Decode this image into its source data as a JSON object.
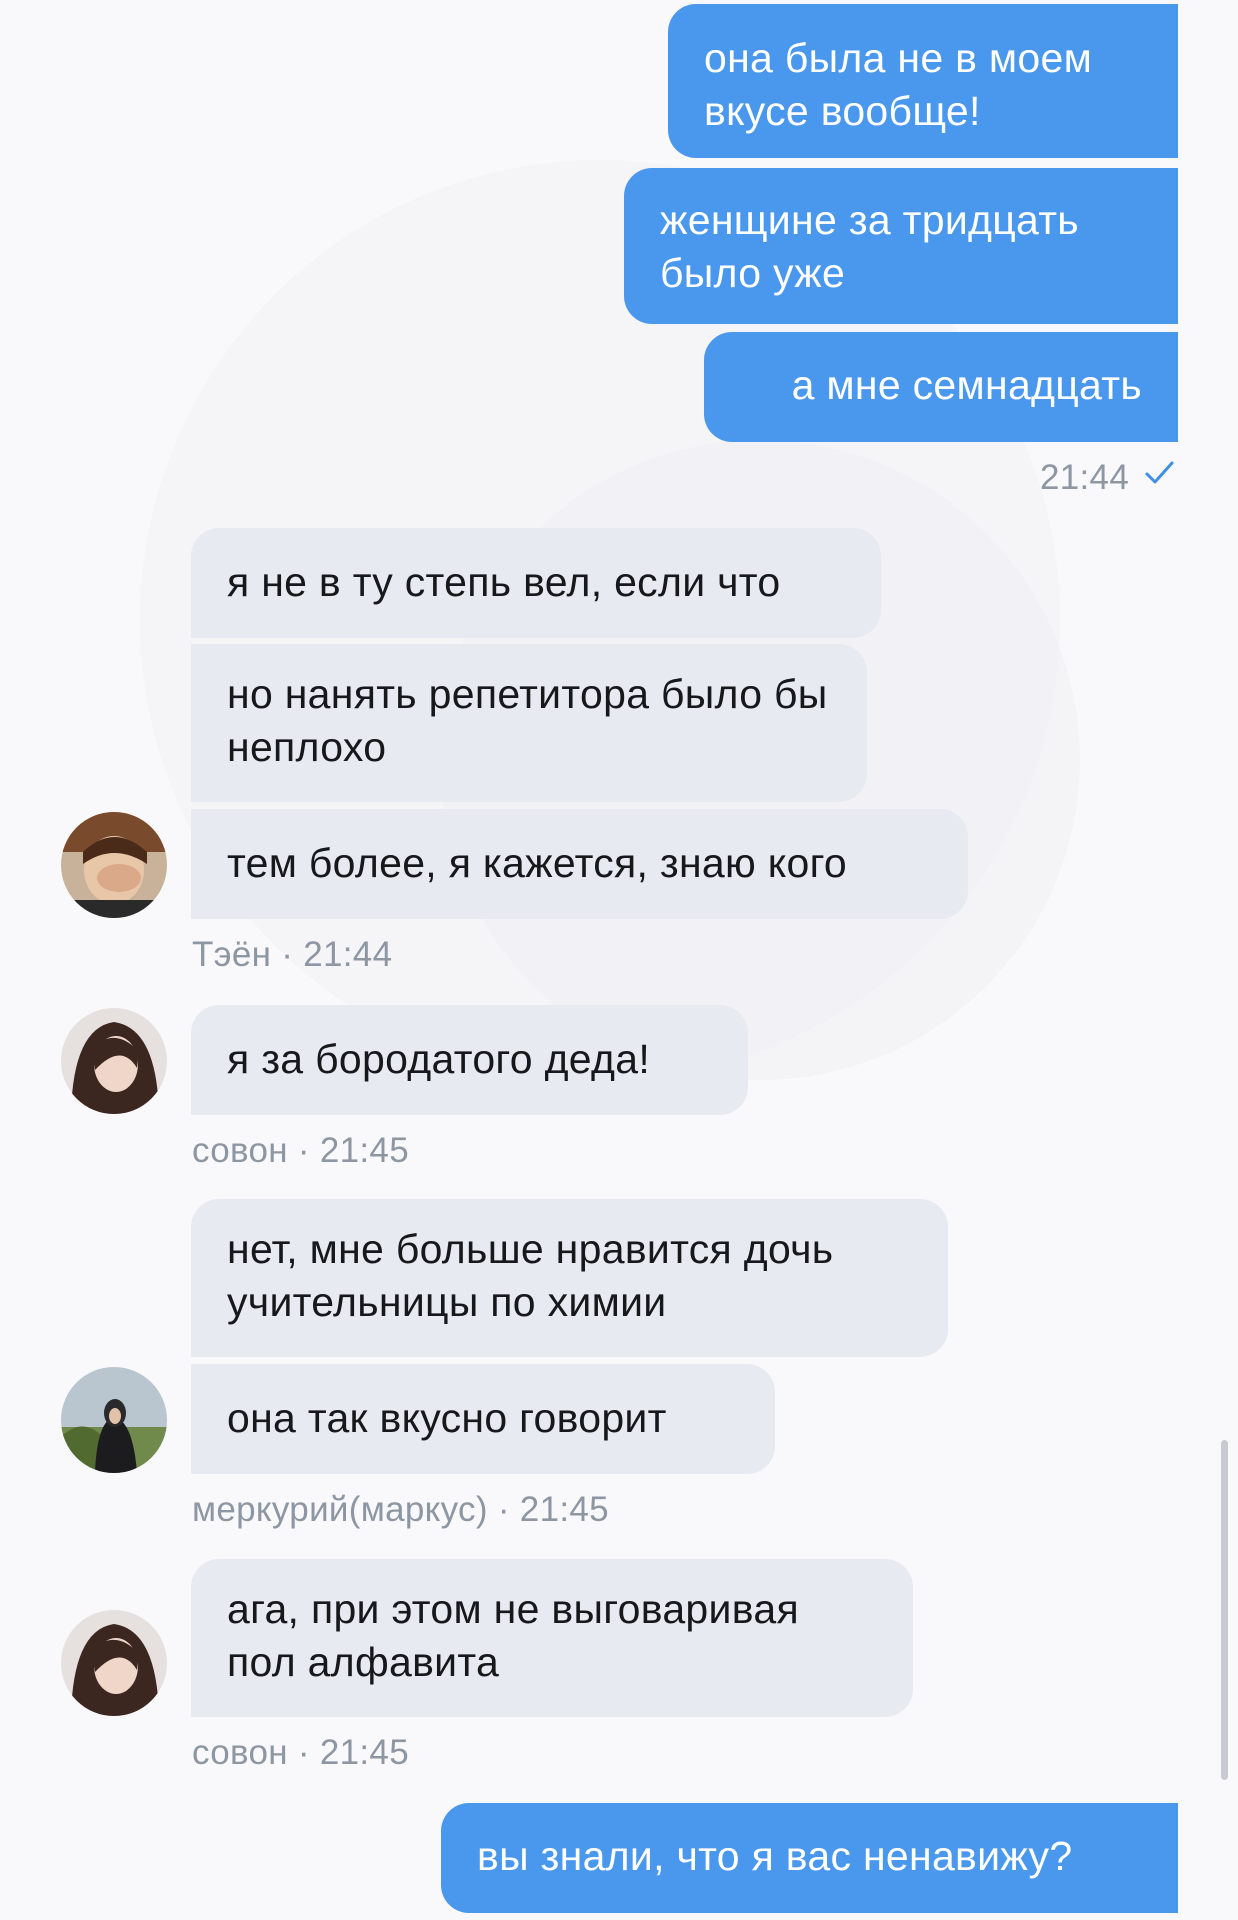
{
  "outgoing_group_1": {
    "messages": [
      "она была не в моем вкусе вообще!",
      "женщине за тридцать было уже",
      "а мне семнадцать"
    ],
    "time": "21:44",
    "status_icon": "check-icon"
  },
  "incoming_groups": [
    {
      "sender": "Тэён",
      "time": "· 21:44",
      "messages": [
        "я не в ту степь вел, если что",
        "но нанять репетитора было бы неплохо",
        "тем более, я кажется, знаю кого"
      ]
    },
    {
      "sender": "совон",
      "time": "· 21:45",
      "messages": [
        "я за бородатого деда!"
      ]
    },
    {
      "sender": "меркурий(маркус)",
      "time": "· 21:45",
      "messages": [
        "нет, мне больше нравится дочь учительницы по химии",
        "она так вкусно говорит"
      ]
    },
    {
      "sender": "совон",
      "time": "· 21:45",
      "messages": [
        "ага, при этом не выговаривая пол алфавита"
      ]
    }
  ],
  "outgoing_group_2": {
    "messages": [
      "вы знали, что я вас ненавижу?"
    ]
  },
  "colors": {
    "outgoing_bubble": "#4a97ee",
    "incoming_bubble": "#e8eaf1",
    "meta_text": "#8d96a3",
    "background": "#f9f9fb"
  }
}
